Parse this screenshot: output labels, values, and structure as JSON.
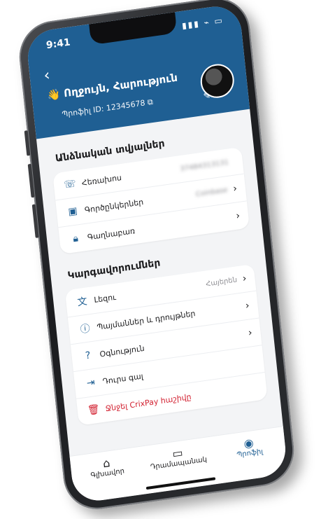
{
  "status": {
    "time": "9:41"
  },
  "header": {
    "greeting": "👋 Ողջույն, Հարություն",
    "profile_id": "Պրոֆիլ ID: 12345678"
  },
  "personal": {
    "title": "Անձնական տվյալներ",
    "items": [
      {
        "label": "Հեռախոս",
        "value": "37484313131"
      },
      {
        "label": "Գործընկերներ",
        "value": "Coinbase"
      },
      {
        "label": "Գաղնաբառ",
        "value": ""
      }
    ]
  },
  "settings": {
    "title": "Կարգավորումներ",
    "items": [
      {
        "label": "Լեզու",
        "value": "Հայերեն"
      },
      {
        "label": "Պայմաններ և դրույթներ",
        "value": ""
      },
      {
        "label": "Օգնություն",
        "value": ""
      },
      {
        "label": "Դուրս գալ",
        "value": ""
      },
      {
        "label": "Ջնջել CrixPay հաշիվը",
        "value": ""
      }
    ]
  },
  "tabbar": {
    "items": [
      {
        "label": "Գլխավոր"
      },
      {
        "label": "Դրամապանակ"
      },
      {
        "label": "Պրոֆիլ"
      }
    ]
  },
  "colors": {
    "header_bg": "#1f5f93",
    "danger": "#d21f2f"
  },
  "icons": [
    "back-chevron-icon",
    "phone-icon",
    "briefcase-icon",
    "lock-icon",
    "translate-icon",
    "info-icon",
    "help-icon",
    "logout-icon",
    "trash-icon",
    "home-icon",
    "wallet-icon",
    "profile-icon",
    "edit-icon",
    "copy-icon"
  ]
}
